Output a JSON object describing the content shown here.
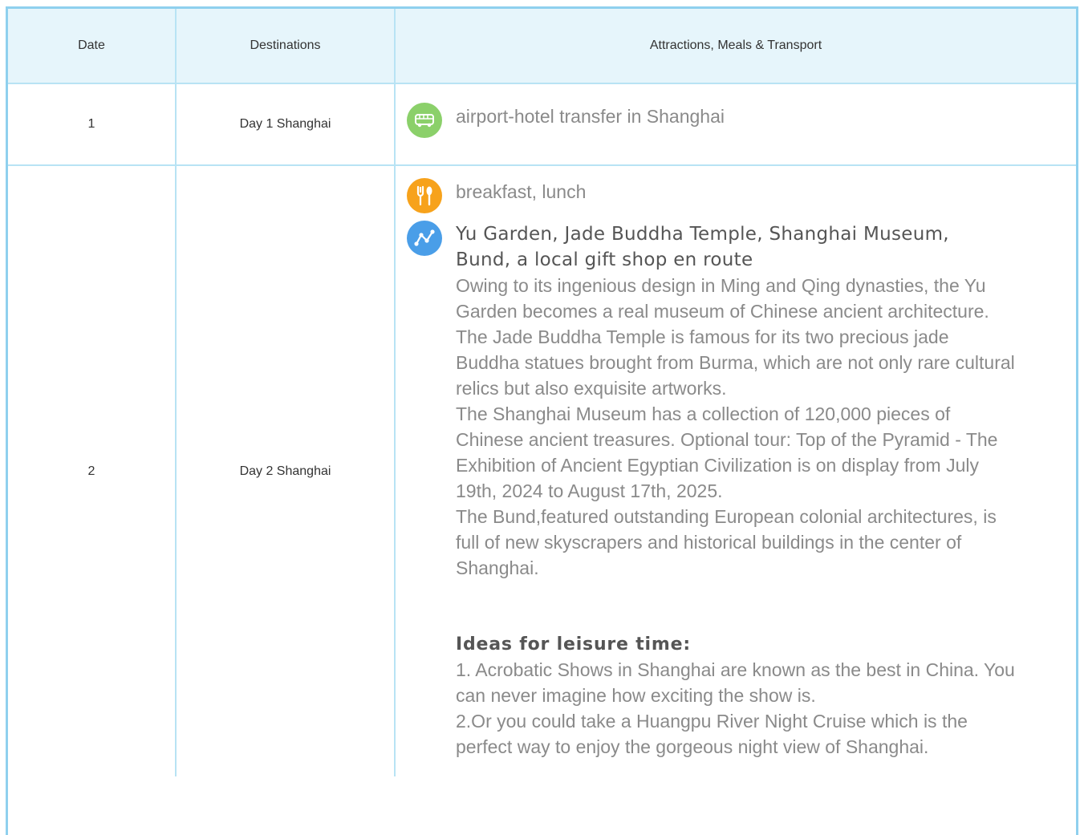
{
  "table": {
    "headers": {
      "date": "Date",
      "destinations": "Destinations",
      "attractions": "Attractions, Meals & Transport"
    },
    "rows": [
      {
        "date": "1",
        "destination": "Day 1 Shanghai",
        "transport": "airport-hotel transfer in Shanghai"
      },
      {
        "date": "2",
        "destination": "Day 2 Shanghai",
        "meals": "breakfast, lunch",
        "attractions_title_line1": "Yu Garden, Jade Buddha Temple, Shanghai Museum,",
        "attractions_title_line2": "Bund, a local gift shop en route",
        "descriptions": [
          "Owing to its ingenious design in Ming and Qing dynasties, the Yu Garden becomes a real museum of Chinese ancient architecture.",
          "The Jade Buddha Temple is famous for its two precious jade Buddha statues brought from Burma, which are not only rare cultural relics but also exquisite artworks.",
          "The Shanghai Museum has a collection of 120,000 pieces of Chinese ancient treasures. Optional tour: Top of the Pyramid - The Exhibition of Ancient Egyptian Civilization is on display from July 19th, 2024 to August 17th, 2025.",
          "The Bund,featured outstanding European colonial architectures, is full of new skyscrapers and historical buildings in the center of Shanghai."
        ],
        "leisure_heading": "Ideas for leisure time:",
        "leisure_items": [
          "1. Acrobatic Shows in Shanghai are known as the best in China. You can never imagine how exciting the show is.",
          "2.Or you could take a Huangpu River Night Cruise which is the perfect way to enjoy the gorgeous night view of Shanghai."
        ]
      }
    ]
  },
  "icons": {
    "transport": "bus-icon",
    "meals": "fork-knife-icon",
    "attractions": "route-icon"
  },
  "colors": {
    "border": "#8fd0ee",
    "header_bg": "#e6f5fb",
    "bus_icon": "#8bd06a",
    "meal_icon": "#f7a21b",
    "route_icon": "#4a9ee8"
  }
}
